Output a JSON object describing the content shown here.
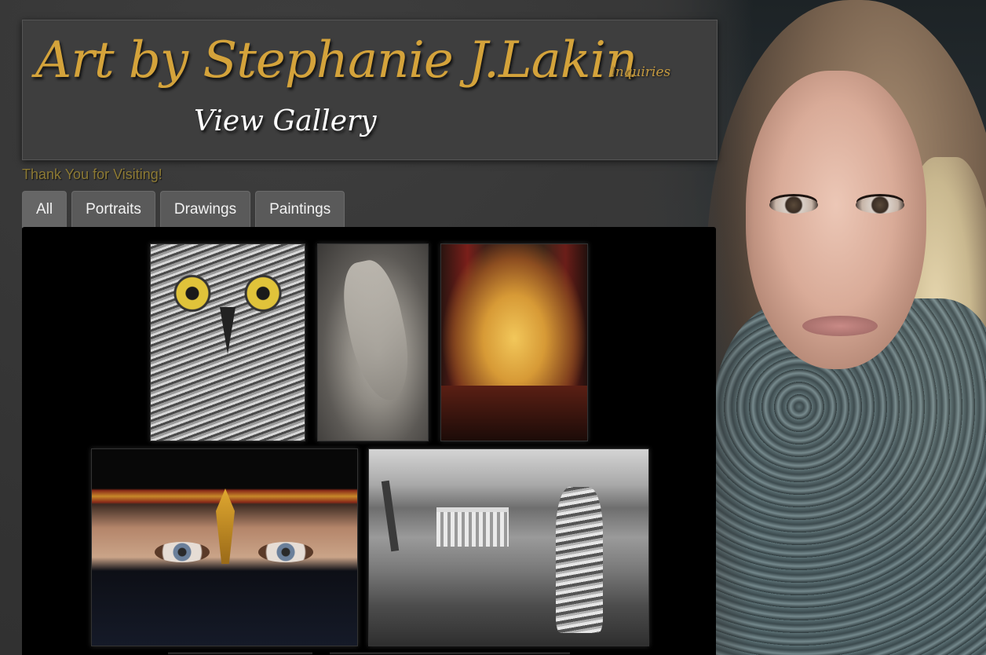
{
  "header": {
    "title": "Art by Stephanie J.Lakin",
    "inquiries_label": "Inquiries",
    "view_gallery_label": "View Gallery"
  },
  "welcome_text": "Thank You for Visiting!",
  "tabs": [
    {
      "label": "All",
      "active": true
    },
    {
      "label": "Portraits",
      "active": false
    },
    {
      "label": "Drawings",
      "active": false
    },
    {
      "label": "Paintings",
      "active": false
    }
  ],
  "gallery": {
    "items": [
      {
        "subject": "owl"
      },
      {
        "subject": "seal"
      },
      {
        "subject": "madonna"
      },
      {
        "subject": "veiled-woman"
      },
      {
        "subject": "temple-landscape"
      }
    ]
  },
  "colors": {
    "title_gold": "#d4a33b",
    "background": "#383838",
    "tab_bg": "#5a5a5a",
    "gallery_bg": "#000000",
    "welcome_text": "#8d7a34"
  }
}
